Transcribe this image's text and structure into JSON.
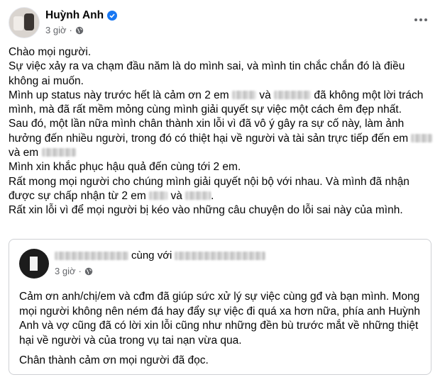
{
  "post": {
    "author": "Huỳnh Anh",
    "time": "3 giờ",
    "separator": "·",
    "paragraphs": {
      "p1": "Chào mọi người.",
      "p2": "Sự việc xảy ra va chạm đầu năm là do mình sai, và mình tin chắc chắn đó là điều không ai muốn.",
      "p3a": "Mình up status này trước hết là cảm ơn 2 em",
      "p3b": "và",
      "p3c": "đã không một lời trách mình, mà đã rất mềm mỏng cùng mình giải quyết sự việc một cách êm đẹp nhất.",
      "p4a": "Sau đó, một lần nữa mình chân thành xin lỗi vì đã vô ý gây ra sự cố này, làm ảnh hưởng đến nhiều người, trong đó có thiệt hại về người và tài sản trực tiếp đến em",
      "p4b": "và em",
      "p5": "Mình xin khắc phục hậu quả đến cùng tới 2 em.",
      "p6a": "Rất mong mọi người cho chúng mình giải quyết nội bộ với nhau. Và mình đã nhận được sự chấp nhận từ 2 em",
      "p6b": "và",
      "p6c": ".",
      "p7": "Rất xin lỗi vì để mọi người bị kéo vào những câu chuyện do lỗi sai này của mình."
    }
  },
  "shared": {
    "with_label": "cùng với",
    "time": "3 giờ",
    "separator": "·",
    "paragraph1": "Cảm ơn anh/chị/em và cđm đã giúp sức xử lý sự việc cùng gđ và bạn mình. Mong mọi người không nên ném đá hay đẩy sự việc đi quá xa hơn nữa, phía anh Huỳnh Anh và vợ cũng đã có lời xin lỗi cũng như những đền bù trước mắt về những thiệt hại về người và của trong vụ tai nạn vừa qua.",
    "paragraph2": "Chân thành cảm ơn mọi người đã đọc."
  },
  "colors": {
    "verified_badge": "#1877f2",
    "meta_text": "#65676b",
    "card_border": "#ced0d4"
  },
  "icons": [
    "verified-badge-icon",
    "globe-icon",
    "more-options-icon"
  ]
}
